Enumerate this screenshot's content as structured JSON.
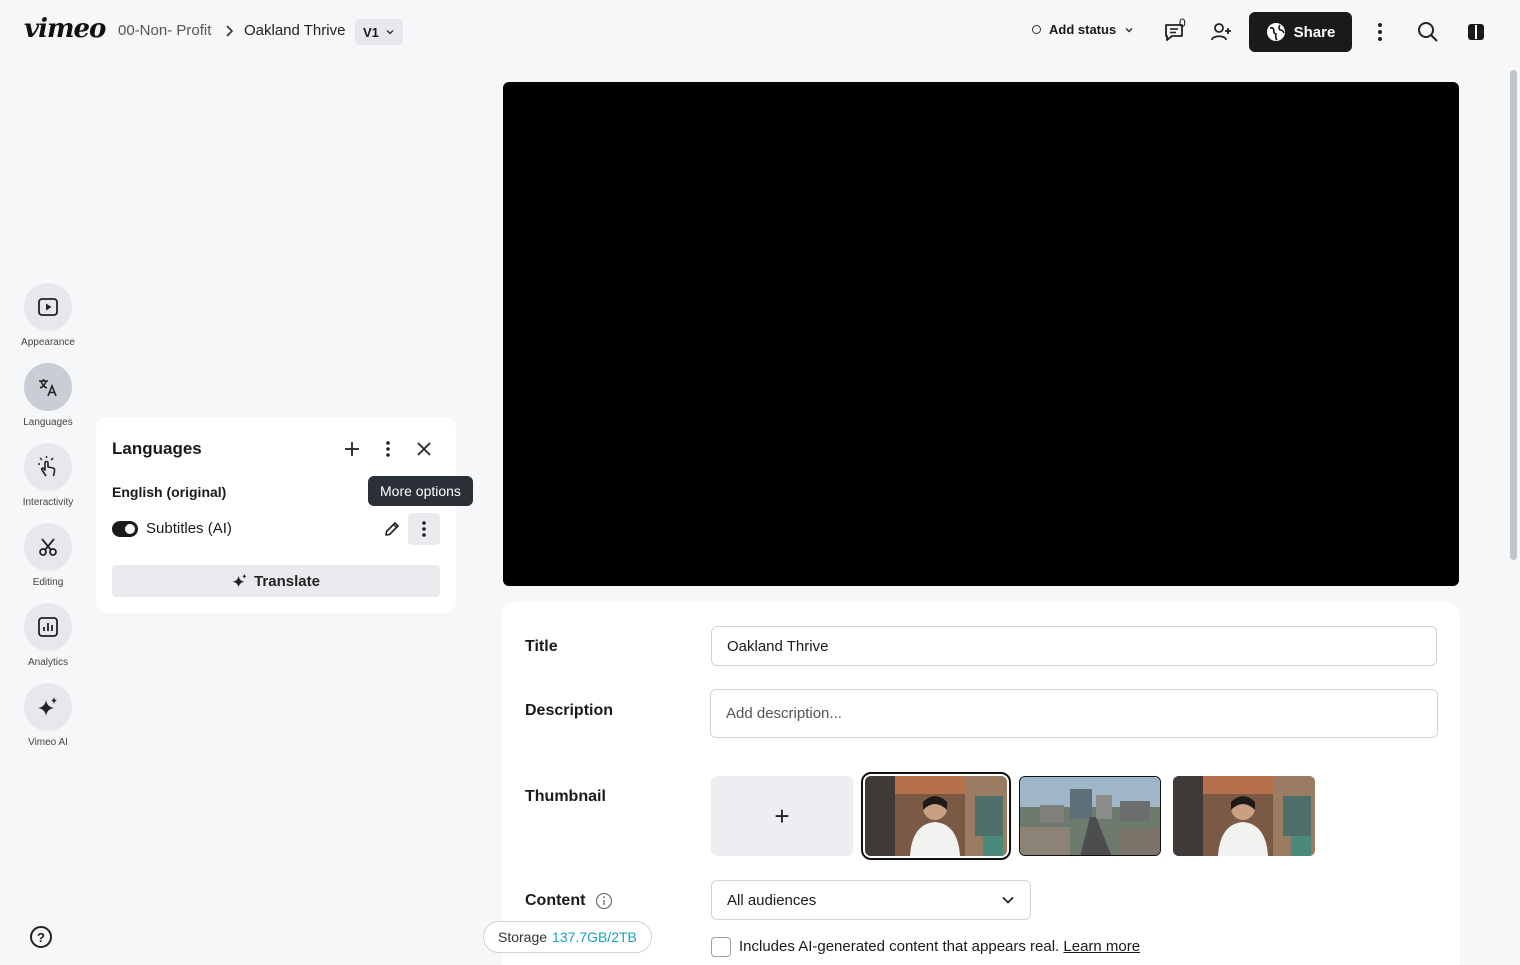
{
  "header": {
    "logo": "vimeo",
    "breadcrumb": [
      "00-Non- Profit",
      "Oakland Thrive"
    ],
    "version": "V1",
    "status_label": "Add status",
    "comment_count": "0",
    "share_label": "Share"
  },
  "rail": {
    "items": [
      {
        "label": "Appearance",
        "icon": "play-square-icon"
      },
      {
        "label": "Languages",
        "icon": "translate-icon"
      },
      {
        "label": "Interactivity",
        "icon": "tap-hand-icon"
      },
      {
        "label": "Editing",
        "icon": "scissors-icon"
      },
      {
        "label": "Analytics",
        "icon": "bar-chart-icon"
      },
      {
        "label": "Vimeo AI",
        "icon": "sparkle-icon"
      }
    ],
    "active": "Languages"
  },
  "languages_panel": {
    "title": "Languages",
    "language": "English (original)",
    "track_label": "Subtitles (AI)",
    "track_enabled": true,
    "translate_label": "Translate",
    "tooltip": "More options"
  },
  "details": {
    "title_label": "Title",
    "title_value": "Oakland Thrive",
    "description_label": "Description",
    "description_placeholder": "Add description...",
    "thumbnail_label": "Thumbnail",
    "content_label": "Content",
    "content_value": "All audiences",
    "ai_text": "Includes AI-generated content that appears real.",
    "learn_more": "Learn more"
  },
  "storage": {
    "label": "Storage",
    "value": "137.7GB/2TB"
  },
  "colors": {
    "accent": "#17a2c5",
    "dark": "#1a1a1a",
    "background": "#f6f7f9"
  }
}
